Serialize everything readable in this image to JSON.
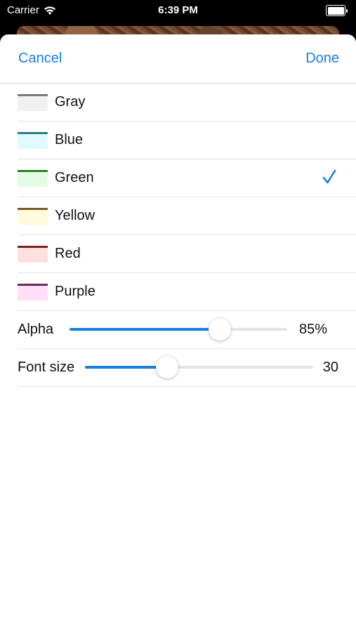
{
  "status_bar": {
    "carrier": "Carrier",
    "time": "6:39 PM",
    "icons": [
      "wifi-icon",
      "battery-icon"
    ]
  },
  "nav": {
    "cancel_label": "Cancel",
    "done_label": "Done"
  },
  "colors": {
    "accent": "#1a7fe0",
    "items": [
      {
        "label": "Gray",
        "line_color": "#7a7a7a",
        "fill_color": "#f0f0f0",
        "selected": false
      },
      {
        "label": "Blue",
        "line_color": "#2a7f7f",
        "fill_color": "#e0fbff",
        "selected": false
      },
      {
        "label": "Green",
        "line_color": "#2e7d2e",
        "fill_color": "#e2fbe2",
        "selected": true
      },
      {
        "label": "Yellow",
        "line_color": "#7a5a22",
        "fill_color": "#fffbdc",
        "selected": false
      },
      {
        "label": "Red",
        "line_color": "#7a2020",
        "fill_color": "#ffe0e0",
        "selected": false
      },
      {
        "label": "Purple",
        "line_color": "#6a2a5a",
        "fill_color": "#fde0f8",
        "selected": false
      }
    ]
  },
  "alpha": {
    "label": "Alpha",
    "value_text": "85%",
    "fraction": 0.69
  },
  "font_size": {
    "label": "Font size",
    "value_text": "30",
    "fraction": 0.36
  }
}
